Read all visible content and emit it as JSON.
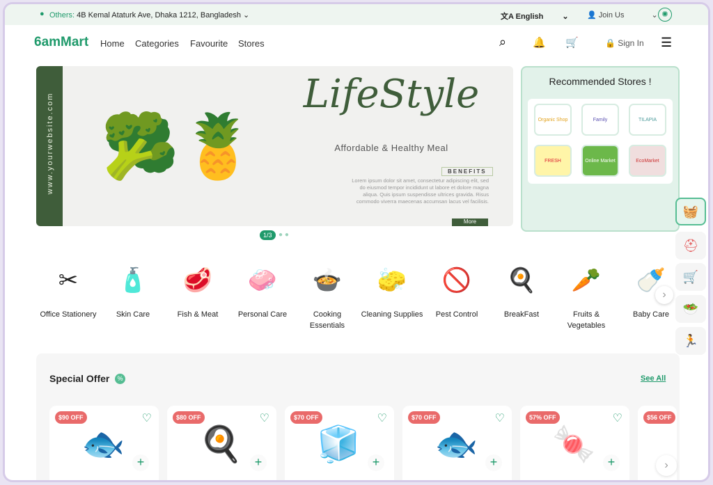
{
  "topbar": {
    "location_prefix": "Others:",
    "address": "4B Kemal Ataturk Ave, Dhaka 1212, Bangladesh",
    "language": "English",
    "join": "Join Us"
  },
  "nav": {
    "logo": "6amMart",
    "links": [
      "Home",
      "Categories",
      "Favourite",
      "Stores"
    ],
    "sign_in": "Sign In"
  },
  "banner": {
    "side_text": "www.yourwebsite.com",
    "title": "LifeStyle",
    "subtitle": "Affordable & Healthy Meal",
    "benefits": "BENEFITS",
    "body": "Lorem ipsum dolor sit amet, consectetur adipiscing elit, sed do eiusmod tempor incididunt ut labore et dolore magna aliqua. Quis ipsum suspendisse ultrices gravida. Risus commodo viverra maecenas accumsan lacus vel facilisis.",
    "more": "More",
    "pager": "1/3"
  },
  "recommended": {
    "title": "Recommended Stores !",
    "stores": [
      "Organic Shop",
      "Family",
      "TILAPIA",
      "FRESH",
      "Online Market",
      "EcoMarket"
    ]
  },
  "categories": [
    {
      "label": "Office Stationery",
      "icon": "✂"
    },
    {
      "label": "Skin Care",
      "icon": "🧴"
    },
    {
      "label": "Fish & Meat",
      "icon": "🥩"
    },
    {
      "label": "Personal Care",
      "icon": "🧼"
    },
    {
      "label": "Cooking Essentials",
      "icon": "🍲"
    },
    {
      "label": "Cleaning Supplies",
      "icon": "🧽"
    },
    {
      "label": "Pest Control",
      "icon": "🚫"
    },
    {
      "label": "BreakFast",
      "icon": "🍳"
    },
    {
      "label": "Fruits & Vegetables",
      "icon": "🥕"
    },
    {
      "label": "Baby Care",
      "icon": "🍼"
    }
  ],
  "special_offer": {
    "title": "Special Offer",
    "see_all": "See All",
    "products": [
      {
        "badge": "$90 OFF",
        "icon": "🐟"
      },
      {
        "badge": "$80 OFF",
        "icon": "🍳"
      },
      {
        "badge": "$70 OFF",
        "icon": "🧊"
      },
      {
        "badge": "$70 OFF",
        "icon": "🐟"
      },
      {
        "badge": "57% OFF",
        "icon": "🍬"
      },
      {
        "badge": "$56 OFF",
        "icon": "🪵"
      }
    ]
  },
  "colors": {
    "brand": "#1f9a6b",
    "badge": "#e96a6a",
    "banner_green": "#3f5d3a"
  }
}
